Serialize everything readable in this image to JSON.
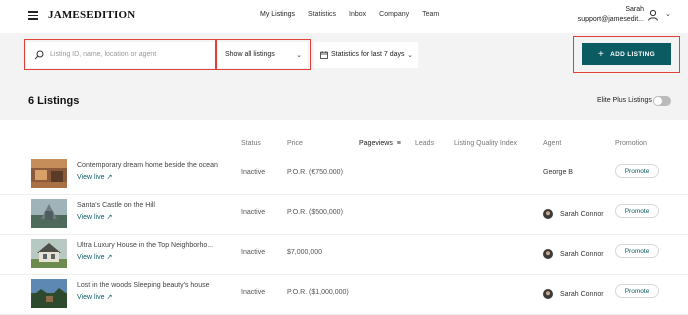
{
  "header": {
    "logo": "JAMESEDITION",
    "nav": [
      "My Listings",
      "Statistics",
      "Inbox",
      "Company",
      "Team"
    ],
    "user_name": "Sarah",
    "user_email": "support@jamesedit..."
  },
  "toolbar": {
    "search_placeholder": "Listing ID, name, location or agent",
    "filter_value": "Show all listings",
    "stats_value": "Statistics for last 7 days",
    "add_label": "ADD LISTING"
  },
  "summary": {
    "count_label": "6 Listings",
    "elite_label": "Elite Plus Listings"
  },
  "table": {
    "columns": [
      "Status",
      "Price",
      "Pageviews",
      "Leads",
      "Listing Quality Index",
      "Agent",
      "Promotion"
    ],
    "view_live": "View live ↗",
    "promote_label": "Promote",
    "rows": [
      {
        "title": "Contemporary dream home beside the ocean",
        "status": "Inactive",
        "price": "P.O.R. (€750.000)",
        "agent": "George B",
        "agent_avatar": false
      },
      {
        "title": "Santa's Castle on the Hill",
        "status": "Inactive",
        "price": "P.O.R. ($500,000)",
        "agent": "Sarah Connor",
        "agent_avatar": true
      },
      {
        "title": "Ultra Luxury House in the Top Neighborho...",
        "status": "Inactive",
        "price": "$7,000,000",
        "agent": "Sarah Connor",
        "agent_avatar": true
      },
      {
        "title": "Lost in the woods Sleeping beauty's house",
        "status": "Inactive",
        "price": "P.O.R. ($1,000,000)",
        "agent": "Sarah Connor",
        "agent_avatar": true
      }
    ]
  },
  "colors": {
    "accent": "#0b5b63",
    "highlight": "#e0413a"
  }
}
